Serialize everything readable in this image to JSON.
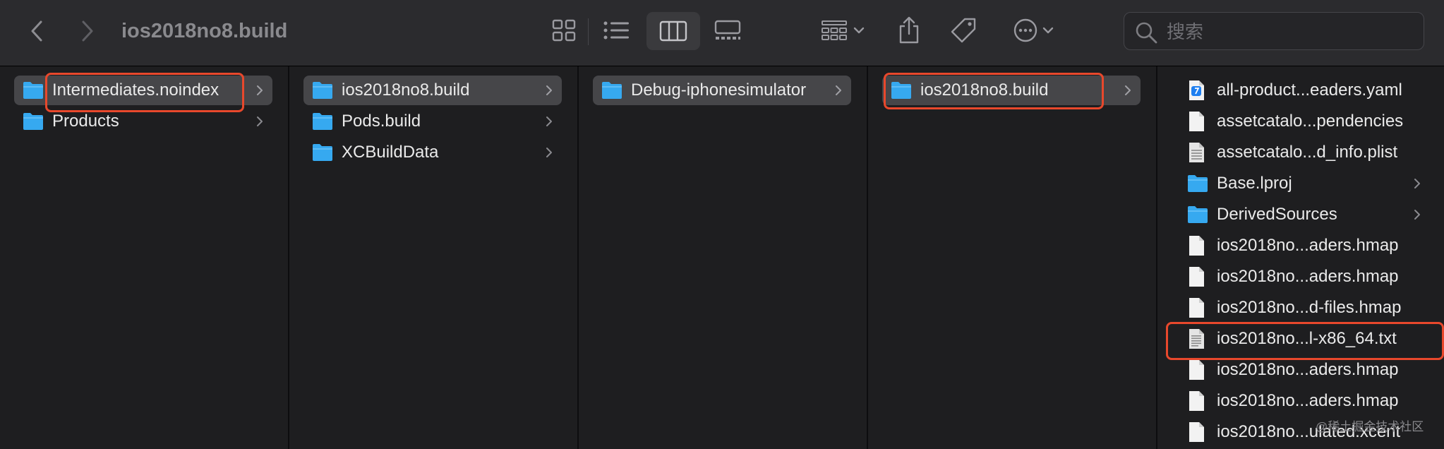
{
  "window": {
    "title": "ios2018no8.build"
  },
  "search": {
    "placeholder": "搜索",
    "value": ""
  },
  "columns": [
    {
      "items": [
        {
          "label": "Intermediates.noindex",
          "icon": "folder",
          "chevron": true,
          "selected": true
        },
        {
          "label": "Products",
          "icon": "folder",
          "chevron": true
        }
      ]
    },
    {
      "items": [
        {
          "label": "ios2018no8.build",
          "icon": "folder",
          "chevron": true,
          "selected": true
        },
        {
          "label": "Pods.build",
          "icon": "folder",
          "chevron": true
        },
        {
          "label": "XCBuildData",
          "icon": "folder",
          "chevron": true
        }
      ]
    },
    {
      "items": [
        {
          "label": "Debug-iphonesimulator",
          "icon": "folder",
          "chevron": true,
          "selected": true
        }
      ]
    },
    {
      "items": [
        {
          "label": "ios2018no8.build",
          "icon": "folder",
          "chevron": true,
          "selected": true
        }
      ]
    },
    {
      "items": [
        {
          "label": "all-product...eaders.yaml",
          "icon": "yaml"
        },
        {
          "label": "assetcatalo...pendencies",
          "icon": "doc"
        },
        {
          "label": "assetcatalo...d_info.plist",
          "icon": "plist"
        },
        {
          "label": "Base.lproj",
          "icon": "folder",
          "chevron": true
        },
        {
          "label": "DerivedSources",
          "icon": "folder",
          "chevron": true
        },
        {
          "label": "ios2018no...aders.hmap",
          "icon": "doc"
        },
        {
          "label": "ios2018no...aders.hmap",
          "icon": "doc"
        },
        {
          "label": "ios2018no...d-files.hmap",
          "icon": "doc"
        },
        {
          "label": "ios2018no...l-x86_64.txt",
          "icon": "txt"
        },
        {
          "label": "ios2018no...aders.hmap",
          "icon": "doc"
        },
        {
          "label": "ios2018no...aders.hmap",
          "icon": "doc"
        },
        {
          "label": "ios2018no...ulated.xcent",
          "icon": "doc"
        }
      ]
    }
  ],
  "watermark": "@稀土掘金技术社区",
  "colors": {
    "highlight": "#e8482c",
    "folder": "#36a9f0",
    "selection": "#464649"
  }
}
